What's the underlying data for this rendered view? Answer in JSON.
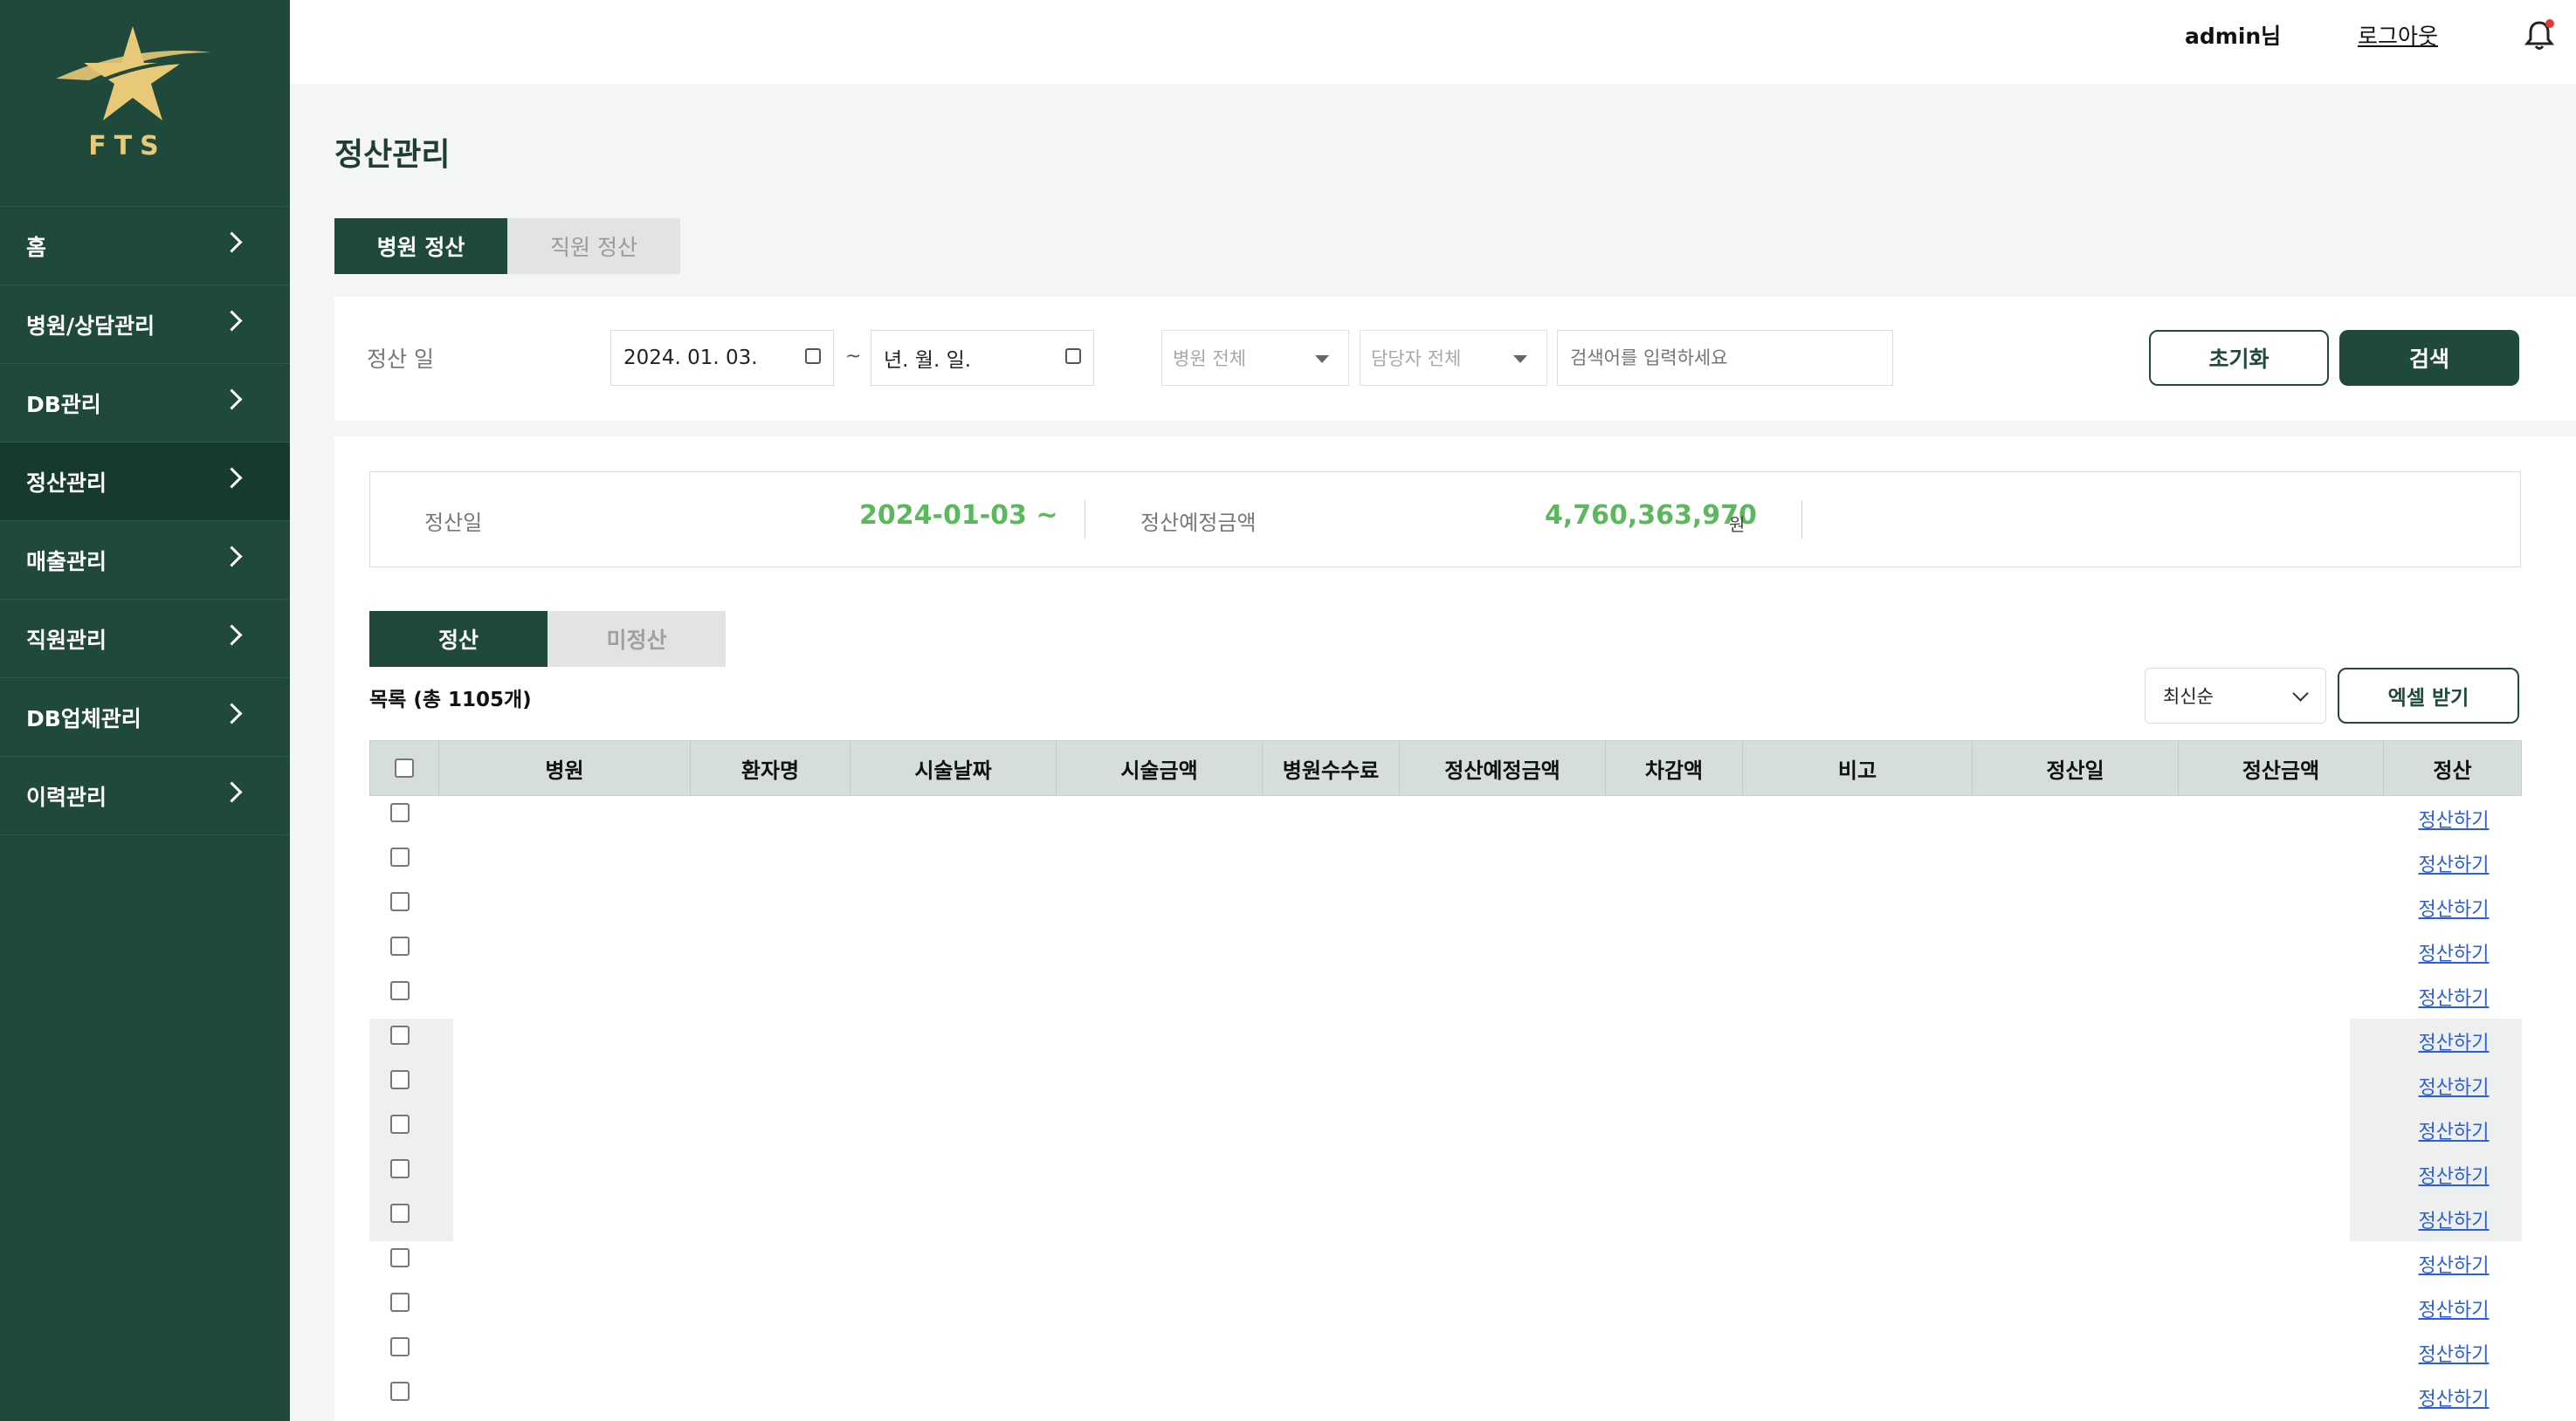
{
  "brand": {
    "logo_text": "FTS"
  },
  "sidebar": {
    "items": [
      {
        "label": "홈"
      },
      {
        "label": "병원/상담관리"
      },
      {
        "label": "DB관리"
      },
      {
        "label": "정산관리"
      },
      {
        "label": "매출관리"
      },
      {
        "label": "직원관리"
      },
      {
        "label": "DB업체관리"
      },
      {
        "label": "이력관리"
      }
    ],
    "active_index": 3
  },
  "header": {
    "user": "admin님",
    "logout": "로그아웃",
    "icon": "bell-icon",
    "notification_dot_color": "#e53935"
  },
  "page": {
    "title": "정산관리"
  },
  "tabs": [
    {
      "label": "병원 정산",
      "active": true
    },
    {
      "label": "직원 정산",
      "active": false
    }
  ],
  "filter": {
    "label": "정산 일",
    "date_from": "2024. 01. 03.",
    "date_to": "년. 월. 일.",
    "separator": "~",
    "hospital_select": "병원 전체",
    "manager_select": "담당자 전체",
    "search_placeholder": "검색어를 입력하세요",
    "reset_label": "초기화",
    "search_label": "검색"
  },
  "summary": {
    "date_label": "정산일",
    "date_value": "2024-01-03 ~",
    "amount_label": "정산예정금액",
    "amount_value": "4,760,363,970",
    "amount_unit": "원"
  },
  "subtabs": [
    {
      "label": "정산",
      "active": true
    },
    {
      "label": "미정산",
      "active": false
    }
  ],
  "list": {
    "count_label": "목록 (총 1105개)",
    "sort": "최신순",
    "excel_label": "엑셀 받기",
    "columns": [
      "병원",
      "환자명",
      "시술날짜",
      "시술금액",
      "병원수수료",
      "정산예정금액",
      "차감액",
      "비고",
      "정산일",
      "정산금액",
      "정산"
    ],
    "row_action": "정산하기",
    "visible_rows": 14
  },
  "colors": {
    "primary": "#1f4a3b",
    "accent_value": "#5cb85c",
    "link": "#2b5fd3",
    "logo_gold": "#e7c977"
  }
}
